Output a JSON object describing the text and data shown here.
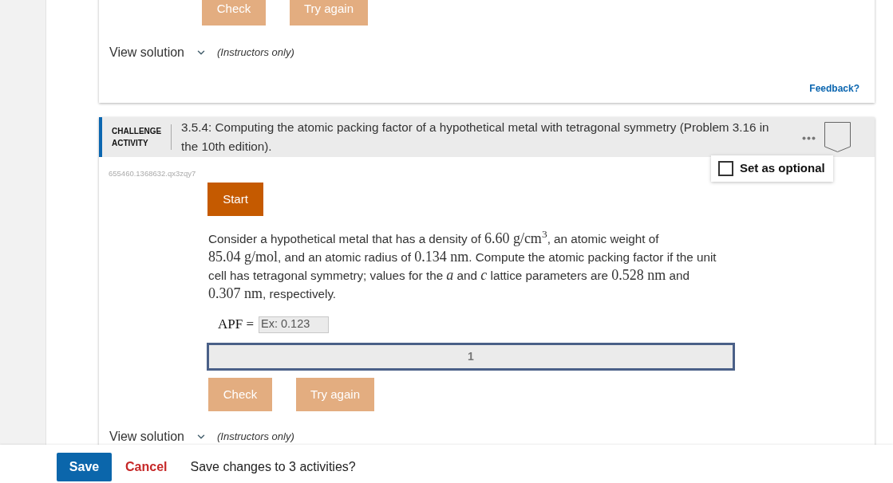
{
  "previous_activity": {
    "buttons": [
      {
        "label": "Check",
        "disabled": true
      },
      {
        "label": "Try again",
        "disabled": true
      }
    ],
    "view_solution": {
      "label": "View solution",
      "expanded": false,
      "note": "(Instructors only)"
    },
    "feedback_link": "Feedback?"
  },
  "challenge_activity": {
    "type_label": "CHALLENGE ACTIVITY",
    "title": "3.5.4: Computing the atomic packing factor of a hypothetical metal with tetragonal symmetry (Problem 3.16 in the 10th edition).",
    "set_optional": {
      "label": "Set as optional",
      "checked": false
    },
    "activity_id": "655460.1368632.qx3zqy7",
    "start_button": {
      "label": "Start",
      "disabled": false
    },
    "question": [
      {
        "kind": "text",
        "text": "Consider a hypothetical metal that has a density of "
      },
      {
        "kind": "math",
        "text": "6.60 g/cm$^{3}$"
      },
      {
        "kind": "text",
        "text": ", an atomic weight of "
      },
      {
        "kind": "math",
        "text": "85.04 g/mol"
      },
      {
        "kind": "text",
        "text": ", and an atomic radius of "
      },
      {
        "kind": "math",
        "text": "0.134 nm"
      },
      {
        "kind": "text",
        "text": ". Compute the atomic packing factor if the unit cell has tetragonal symmetry; values for the "
      },
      {
        "kind": "math",
        "text": "*a*"
      },
      {
        "kind": "text",
        "text": " and "
      },
      {
        "kind": "math",
        "text": "*c*"
      },
      {
        "kind": "text",
        "text": " lattice parameters are "
      },
      {
        "kind": "math",
        "text": "0.528 nm"
      },
      {
        "kind": "text",
        "text": " and "
      },
      {
        "kind": "math",
        "text": "0.307 nm"
      },
      {
        "kind": "text",
        "text": ", respectively."
      }
    ],
    "answer": {
      "label": "APF =",
      "placeholder": "Ex: 0.123"
    },
    "levels": [
      {
        "label": "1",
        "selected": true
      }
    ],
    "buttons": [
      {
        "label": "Check",
        "disabled": true
      },
      {
        "label": "Try again",
        "disabled": true
      }
    ],
    "view_solution": {
      "label": "View solution",
      "expanded": false,
      "note": "(Instructors only)"
    }
  },
  "footer": {
    "save": "Save",
    "cancel": "Cancel",
    "message": "Save changes to 3 activities?"
  }
}
